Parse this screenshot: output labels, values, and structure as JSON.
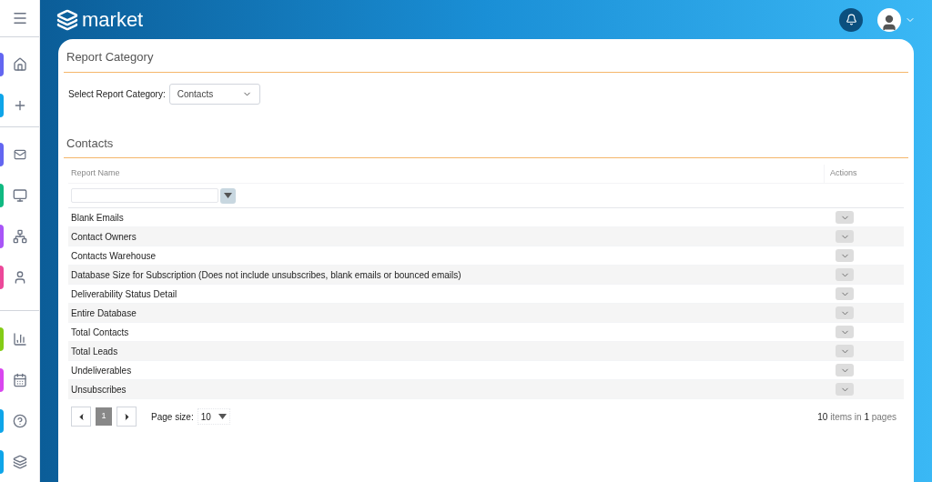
{
  "sidebar": {
    "groups": [
      {
        "items": [
          {
            "color": "#6366f1"
          },
          {
            "color": "#0ea5e9"
          }
        ]
      },
      {
        "items": [
          {
            "color": "#6366f1"
          },
          {
            "color": "#10b981"
          },
          {
            "color": "#a855f7"
          },
          {
            "color": "#ec4899"
          }
        ]
      },
      {
        "items": [
          {
            "color": "#84cc16"
          },
          {
            "color": "#d946ef"
          },
          {
            "color": "#0ea5e9"
          },
          {
            "color": "#0ea5e9"
          }
        ]
      }
    ]
  },
  "header": {
    "logo": "market"
  },
  "report_category": {
    "title": "Report Category",
    "label": "Select Report Category:",
    "value": "Contacts"
  },
  "section": {
    "title": "Contacts"
  },
  "table": {
    "columns": [
      "Report Name",
      "Actions"
    ],
    "rows": [
      {
        "name": "Blank Emails"
      },
      {
        "name": "Contact Owners"
      },
      {
        "name": "Contacts Warehouse"
      },
      {
        "name": "Database Size for Subscription (Does not include unsubscribes, blank emails or bounced emails)"
      },
      {
        "name": "Deliverability Status Detail"
      },
      {
        "name": "Entire Database"
      },
      {
        "name": "Total Contacts"
      },
      {
        "name": "Total Leads"
      },
      {
        "name": "Undeliverables"
      },
      {
        "name": "Unsubscribes"
      }
    ]
  },
  "pager": {
    "pages": [
      {
        "label": "1",
        "selected": true
      }
    ],
    "page_size_label": "Page size:",
    "page_size": "10",
    "summary": "**10** items in **1** pages"
  }
}
